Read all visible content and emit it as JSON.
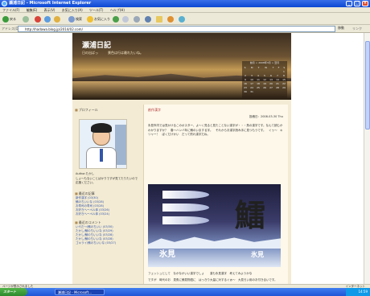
{
  "window": {
    "title": "瀬浦日記 - Microsoft Internet Explorer",
    "min": "_",
    "max": "□",
    "close": "×"
  },
  "menu": [
    "ファイル(F)",
    "編集(E)",
    "表示(V)",
    "お気に入り(A)",
    "ツール(T)",
    "ヘルプ(H)"
  ],
  "toolbar": {
    "back": "戻る",
    "search": "検索",
    "favorites": "お気に入り"
  },
  "address": {
    "label": "アドレス(D)",
    "url": "http://hadawa.blog.jp/2014/02.com/",
    "go": "移動",
    "links": "リンク"
  },
  "blog": {
    "title": "瀬浦日記",
    "subtitle": "日の出ばっ　　　景色は行は最れたいね。",
    "calendar": {
      "header": "前月 < 2008年3月 > 翌月",
      "days": [
        "S",
        "M",
        "T",
        "W",
        "T",
        "F",
        "S"
      ],
      "weeks": [
        [
          "",
          "",
          "",
          "",
          "",
          "",
          "1"
        ],
        [
          "2",
          "3",
          "4",
          "5",
          "6",
          "7",
          "8"
        ],
        [
          "9",
          "10",
          "11",
          "12",
          "13",
          "14",
          "15"
        ],
        [
          "16",
          "17",
          "18",
          "19",
          "20",
          "21",
          "22"
        ],
        [
          "23",
          "24",
          "25",
          "26",
          "27",
          "28",
          "29"
        ],
        [
          "30",
          "31",
          "",
          "",
          "",
          "",
          ""
        ]
      ]
    },
    "profile_title": "プロフィール",
    "profile_name": "Author.たかし",
    "profile_text": "しょ〜もないことばかりですが見てたりたいので応援ください。",
    "recent_title": "最近の記事",
    "recent_items": [
      "新作漢字 (03/30)",
      "鯖のちいいな (03/28)",
      "お寿司の寿司 (03/28)",
      "お好きヘーペル体 (03/26)",
      "お好きヘーペル体 (03/24)"
    ],
    "comments_title": "最近のコメント",
    "comment_items": [
      "いやだ〜/鯖のちいい (03/30)",
      "たかし/鯖のちいいな (03/29)",
      "たかし/鯖のちいいな (03/28)",
      "たかし/鯖のちいいな (03/28)",
      "ゴキライ/鯖のちいいな (03/27)"
    ],
    "entry_title": "創作漢字",
    "entry_date": "投稿日：2008-03-30 Thu",
    "p1": "氷見市内では見かけるこのポスター、よ〜く見ると見たことない漢字が・・・魚の漢字です。なんて読むかわかりますか？　春〜ハンバ年に鯖のいまする字。　それからお漢字読み手に見つもうです。　ぐぅ〜　キリャー！　ぼくだけかい　だって釣れ漢字だね。",
    "photo_kanji": "鱩",
    "photo_place": "氷見",
    "photo_sign": "氷見",
    "p2": "フェッシュとして　なかなかいい漢字でしょ　　漢も氷見漢字　考えてみようかな",
    "p3": "ですが　時代のお　見魚に鯖見物語に　はっきり大量に対するぐぁ〜　大見ろい用のお付き合いです。"
  },
  "status": {
    "text": "ページが表示されました",
    "zone": "インターネット"
  },
  "taskbar": {
    "start": "スタート",
    "task": "瀬浦日記 - Microsoft...",
    "clock": "14:59"
  }
}
